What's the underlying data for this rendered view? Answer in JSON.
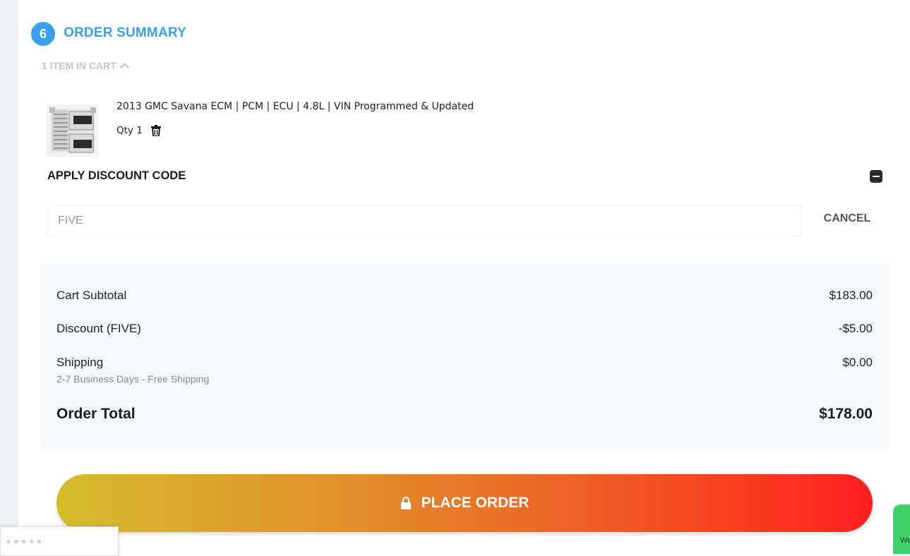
{
  "order_summary": {
    "step_number": "6",
    "title": "ORDER SUMMARY",
    "cart_toggle_label": "1 ITEM IN CART"
  },
  "cart_item": {
    "name": "2013 GMC Savana ECM | PCM | ECU | 4.8L | VIN Programmed & Updated",
    "qty_label": "Qty 1",
    "thumbnail_icon": "ecm-module-image",
    "delete_icon": "trash-icon"
  },
  "discount": {
    "title": "APPLY DISCOUNT CODE",
    "input_value": "FIVE",
    "cancel_label": "CANCEL",
    "collapse_icon": "minus-square-icon"
  },
  "totals": {
    "subtotal_label": "Cart Subtotal",
    "subtotal_value": "$183.00",
    "discount_label": "Discount (FIVE)",
    "discount_value": "-$5.00",
    "shipping_label": "Shipping",
    "shipping_value": "$0.00",
    "shipping_detail": "2-7 Business Days - Free Shipping",
    "total_label": "Order Total",
    "total_value": "$178.00"
  },
  "place_order": {
    "label": "PLACE ORDER",
    "icon": "lock-icon"
  },
  "chat_widget": {
    "text": "We"
  },
  "colors": {
    "accent": "#3aa0ee",
    "button_gradient_start": "#d4bd2b",
    "button_gradient_end": "#ff1f1f",
    "totals_background": "#f5f8fb",
    "chat_green": "#3fd26a"
  }
}
